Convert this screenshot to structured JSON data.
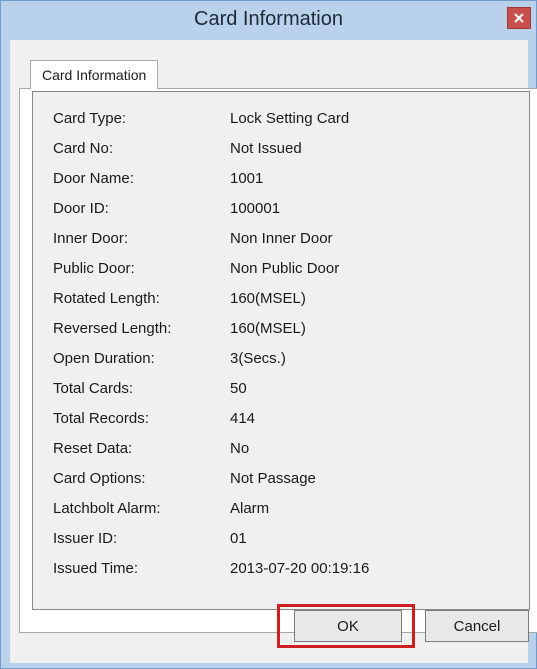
{
  "window": {
    "title": "Card Information"
  },
  "tab": {
    "label": "Card Information"
  },
  "fields": [
    {
      "label": "Card Type:",
      "value": "Lock Setting Card"
    },
    {
      "label": "Card No:",
      "value": "Not Issued"
    },
    {
      "label": "Door Name:",
      "value": "1001"
    },
    {
      "label": "Door ID:",
      "value": "100001"
    },
    {
      "label": "Inner Door:",
      "value": "Non Inner Door"
    },
    {
      "label": "Public Door:",
      "value": "Non Public Door"
    },
    {
      "label": "Rotated Length:",
      "value": "160(MSEL)"
    },
    {
      "label": "Reversed Length:",
      "value": "160(MSEL)"
    },
    {
      "label": "Open Duration:",
      "value": "3(Secs.)"
    },
    {
      "label": "Total Cards:",
      "value": "50"
    },
    {
      "label": "Total Records:",
      "value": "414"
    },
    {
      "label": "Reset Data:",
      "value": "No"
    },
    {
      "label": "Card Options:",
      "value": "Not Passage"
    },
    {
      "label": "Latchbolt Alarm:",
      "value": "Alarm"
    },
    {
      "label": "Issuer ID:",
      "value": "01"
    },
    {
      "label": "Issued Time:",
      "value": "2013-07-20 00:19:16"
    }
  ],
  "buttons": {
    "ok": "OK",
    "cancel": "Cancel"
  },
  "icons": {
    "close": "close-icon"
  },
  "colors": {
    "titlebar": "#b9d1ea",
    "close": "#c7504c",
    "highlight": "#cc1f1f"
  }
}
